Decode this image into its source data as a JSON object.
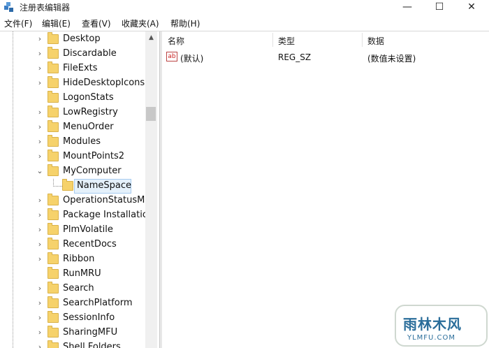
{
  "window": {
    "title": "注册表编辑器",
    "minimize": "—",
    "maximize": "☐",
    "close": "✕"
  },
  "menu": [
    "文件(F)",
    "编辑(E)",
    "查看(V)",
    "收藏夹(A)",
    "帮助(H)"
  ],
  "tree": {
    "items": [
      {
        "label": "Desktop",
        "expander": "›"
      },
      {
        "label": "Discardable",
        "expander": "›"
      },
      {
        "label": "FileExts",
        "expander": "›"
      },
      {
        "label": "HideDesktopIcons",
        "expander": "›"
      },
      {
        "label": "LogonStats",
        "expander": ""
      },
      {
        "label": "LowRegistry",
        "expander": "›"
      },
      {
        "label": "MenuOrder",
        "expander": "›"
      },
      {
        "label": "Modules",
        "expander": "›"
      },
      {
        "label": "MountPoints2",
        "expander": "›"
      },
      {
        "label": "MyComputer",
        "expander": "⌄"
      },
      {
        "label": "NameSpace",
        "expander": "",
        "child": true,
        "selected": true
      },
      {
        "label": "OperationStatusMa",
        "expander": "›"
      },
      {
        "label": "Package Installatio",
        "expander": "›"
      },
      {
        "label": "PlmVolatile",
        "expander": "›"
      },
      {
        "label": "RecentDocs",
        "expander": "›"
      },
      {
        "label": "Ribbon",
        "expander": "›"
      },
      {
        "label": "RunMRU",
        "expander": ""
      },
      {
        "label": "Search",
        "expander": "›"
      },
      {
        "label": "SearchPlatform",
        "expander": "›"
      },
      {
        "label": "SessionInfo",
        "expander": "›"
      },
      {
        "label": "SharingMFU",
        "expander": "›"
      },
      {
        "label": "Shell Folders",
        "expander": "›"
      }
    ]
  },
  "scrollbar": {
    "up_arrow": "▲"
  },
  "list": {
    "columns": [
      "名称",
      "类型",
      "数据"
    ],
    "rows": [
      {
        "icon": "ab",
        "name": "(默认)",
        "type": "REG_SZ",
        "data": "(数值未设置)"
      }
    ]
  },
  "watermark": {
    "text": "雨林木风",
    "url": "YLMFU.COM"
  },
  "colors": {
    "folder": "#f6d26b",
    "selection": "#e5f1fb",
    "watermark": "#2a6d9a"
  }
}
